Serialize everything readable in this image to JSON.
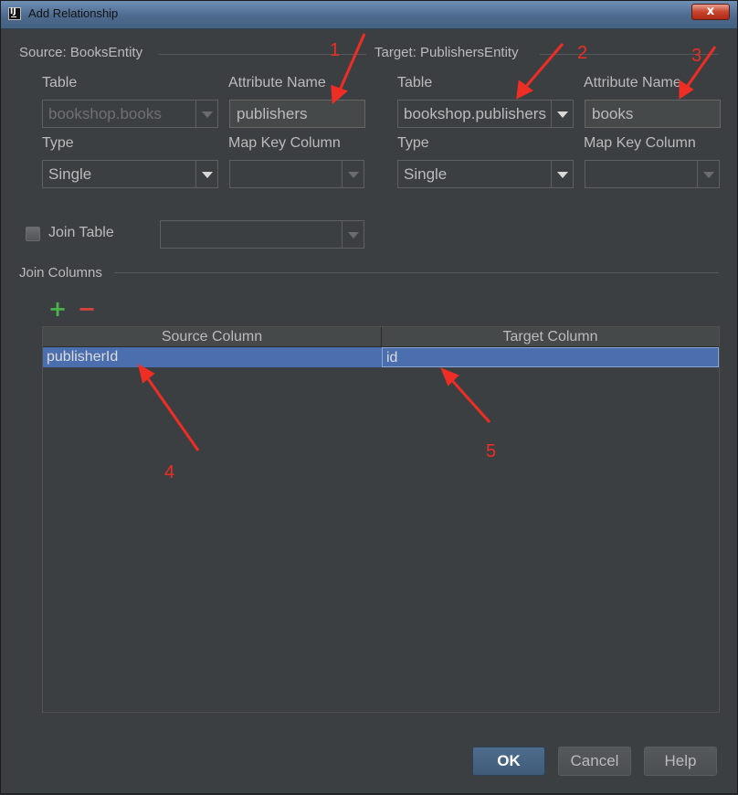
{
  "window": {
    "title": "Add Relationship",
    "close_label": "x"
  },
  "source": {
    "section_label": "Source: BooksEntity",
    "table_label": "Table",
    "table_value": "bookshop.books",
    "attribute_label": "Attribute Name",
    "attribute_value": "publishers",
    "type_label": "Type",
    "type_value": "Single",
    "map_key_label": "Map Key Column",
    "map_key_value": ""
  },
  "target": {
    "section_label": "Target: PublishersEntity",
    "table_label": "Table",
    "table_value": "bookshop.publishers",
    "attribute_label": "Attribute Name",
    "attribute_value": "books",
    "type_label": "Type",
    "type_value": "Single",
    "map_key_label": "Map Key Column",
    "map_key_value": ""
  },
  "join_table": {
    "label": "Join Table",
    "checked": false,
    "value": ""
  },
  "join_columns": {
    "section_label": "Join Columns",
    "add_icon": "plus-icon",
    "remove_icon": "minus-icon",
    "columns": [
      "Source Column",
      "Target Column"
    ],
    "rows": [
      {
        "source": "publisherId",
        "target": "id"
      }
    ]
  },
  "annotations": [
    "1",
    "2",
    "3",
    "4",
    "5"
  ],
  "buttons": {
    "ok": "OK",
    "cancel": "Cancel",
    "help": "Help"
  },
  "colors": {
    "accent_selection": "#4b6eaf",
    "annotation": "#ee2e24",
    "add": "#49b24a",
    "remove": "#d9443a"
  }
}
